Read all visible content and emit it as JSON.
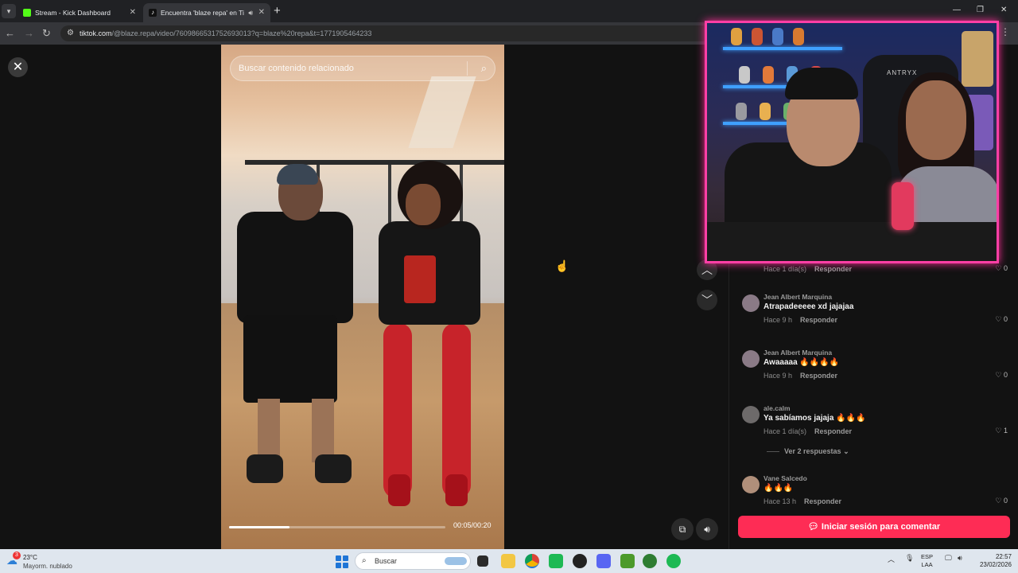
{
  "browser": {
    "tabs": [
      {
        "title": "Stream - Kick Dashboard",
        "favicon_color": "#53fc18"
      },
      {
        "title": "Encuentra 'blaze repa' en Ti",
        "favicon_color": "#ffffff"
      }
    ],
    "url_domain": "tiktok.com",
    "url_path": "/@blaze.repa/video/7609866531752693013?q=blaze%20repa&t=1771905464233"
  },
  "video": {
    "search_placeholder": "Buscar contenido relacionado",
    "time": "00:05/00:20",
    "progress": 0.28
  },
  "comments": [
    {
      "user": "",
      "text": "",
      "time": "Hace 1 día(s)",
      "reply": "Responder",
      "likes": "0",
      "avatar_color": "#444"
    },
    {
      "user": "Jean Albert Marquina",
      "text": "Atrapadeeeee xd jajajaa",
      "time": "Hace 9 h",
      "reply": "Responder",
      "likes": "0",
      "avatar_color": "#8a7a86"
    },
    {
      "user": "Jean Albert Marquina",
      "text": "Awaaaaa 🔥🔥🔥🔥",
      "time": "Hace 9 h",
      "reply": "Responder",
      "likes": "0",
      "avatar_color": "#8a7a86"
    },
    {
      "user": "ale.calm",
      "text": "Ya sabíamos jajaja 🔥🔥🔥",
      "time": "Hace 1 día(s)",
      "reply": "Responder",
      "likes": "1",
      "avatar_color": "#6d6a6a"
    },
    {
      "user": "Vane Salcedo",
      "text": "🔥🔥🔥",
      "time": "Hace 13 h",
      "reply": "Responder",
      "likes": "0",
      "avatar_color": "#b08f7a"
    }
  ],
  "replies_label": "Ver 2 respuestas",
  "login_button": "Iniciar sesión para comentar",
  "webcam": {
    "brand": "ANTRYX"
  },
  "taskbar": {
    "weather_badge": "3",
    "temperature": "23°C",
    "condition": "Mayorm. nublado",
    "search_label": "Buscar",
    "lang_top": "ESP",
    "lang_bottom": "LAA",
    "time": "22:57",
    "date": "23/02/2026"
  },
  "colors": {
    "accent": "#fe2c55",
    "cam_border": "#ff3fa6"
  }
}
